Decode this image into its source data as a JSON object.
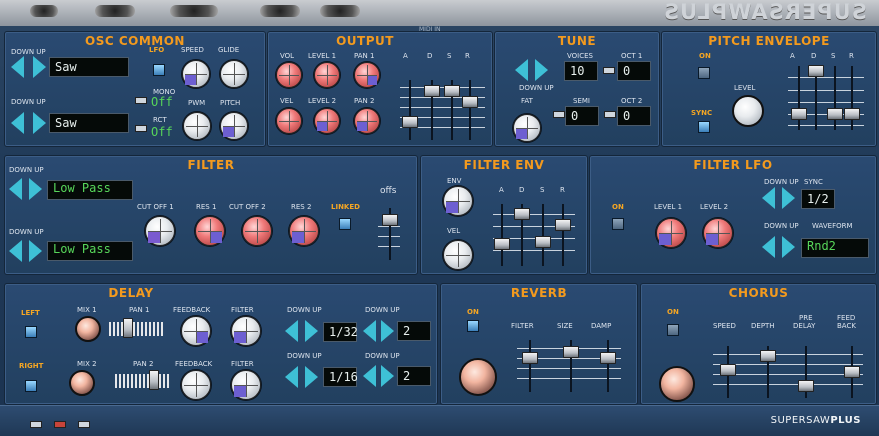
{
  "app": {
    "logo": "SUPERSAWPLUS",
    "midi": "MIDI IN",
    "footer_logo_a": "SUPERSAW",
    "footer_logo_b": "PLUS"
  },
  "labels": {
    "down_up": "DOWN UP"
  },
  "osc": {
    "title": "OSC COMMON",
    "wave1": "Saw",
    "wave2": "Saw",
    "lfo": "LFO",
    "speed": "SPEED",
    "glide": "GLIDE",
    "mono": "MONO",
    "mono_value": "Off",
    "rct": "RCT",
    "rct_value": "Off",
    "pwm": "PWM",
    "pitch": "PITCH"
  },
  "output": {
    "title": "OUTPUT",
    "vol": "VOL",
    "level1": "LEVEL 1",
    "pan1": "PAN 1",
    "vel": "VEL",
    "level2": "LEVEL 2",
    "pan2": "PAN 2",
    "adsr": [
      "A",
      "D",
      "S",
      "R"
    ]
  },
  "tune": {
    "title": "TUNE",
    "voices": "VOICES",
    "voices_value": "10",
    "oct1": "OCT 1",
    "oct1_value": "0",
    "fat": "FAT",
    "semi": "SEMI",
    "semi_value": "0",
    "oct2": "OCT 2",
    "oct2_value": "0"
  },
  "pitch_env": {
    "title": "PITCH ENVELOPE",
    "on": "ON",
    "sync": "SYNC",
    "level": "LEVEL",
    "adsr": [
      "A",
      "D",
      "S",
      "R"
    ]
  },
  "filter": {
    "title": "FILTER",
    "type1": "Low Pass",
    "type2": "Low Pass",
    "cutoff1": "CUT OFF 1",
    "res1": "RES 1",
    "cutoff2": "CUT OFF 2",
    "res2": "RES 2",
    "linked": "LINKED",
    "offs": "offs"
  },
  "filter_env": {
    "title": "FILTER ENV",
    "env": "ENV",
    "vel": "VEL",
    "adsr": [
      "A",
      "D",
      "S",
      "R"
    ]
  },
  "filter_lfo": {
    "title": "FILTER LFO",
    "on": "ON",
    "level1": "LEVEL 1",
    "level2": "LEVEL 2",
    "sync": "SYNC",
    "sync_value": "1/2",
    "waveform": "WAVEFORM",
    "waveform_value": "Rnd2"
  },
  "delay": {
    "title": "DELAY",
    "left": "LEFT",
    "right": "RIGHT",
    "mix1": "MIX 1",
    "pan1": "PAN 1",
    "feedback": "FEEDBACK",
    "filter": "FILTER",
    "mix2": "MIX 2",
    "pan2": "PAN 2",
    "time1": "1/32",
    "count1": "2",
    "time2": "1/16",
    "count2": "2"
  },
  "reverb": {
    "title": "REVERB",
    "on": "ON",
    "filter": "FILTER",
    "size": "SIZE",
    "damp": "DAMP"
  },
  "chorus": {
    "title": "CHORUS",
    "on": "ON",
    "speed": "SPEED",
    "depth": "DEPTH",
    "predelay_a": "PRE",
    "predelay_b": "DELAY",
    "feedback_a": "FEED",
    "feedback_b": "BACK"
  }
}
